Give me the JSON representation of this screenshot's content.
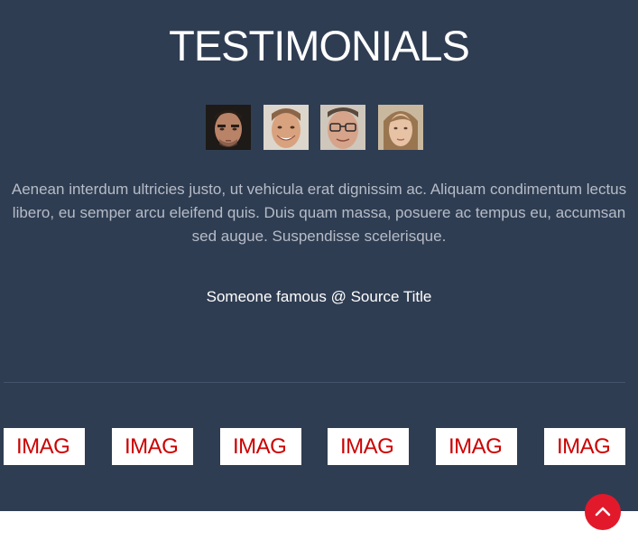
{
  "section": {
    "title": "TESTIMONIALS",
    "background": "#2f3d52"
  },
  "testimonial": {
    "avatars": [
      {
        "name": "avatar-man-stubble"
      },
      {
        "name": "avatar-man-smiling"
      },
      {
        "name": "avatar-man-glasses"
      },
      {
        "name": "avatar-woman"
      }
    ],
    "quote": "Aenean interdum ultricies justo, ut vehicula erat dignissim ac. Aliquam condimentum lectus libero, eu semper arcu eleifend quis. Duis quam massa, posuere ac tempus eu, accumsan sed augue. Suspendisse scelerisque.",
    "author": "Someone famous @ Source Title"
  },
  "logos": [
    "IMAG",
    "IMAG",
    "IMAG",
    "IMAG",
    "IMAG",
    "IMAG"
  ],
  "scroll_top": {
    "icon": "chevron-up-icon",
    "color": "#e2192b"
  }
}
